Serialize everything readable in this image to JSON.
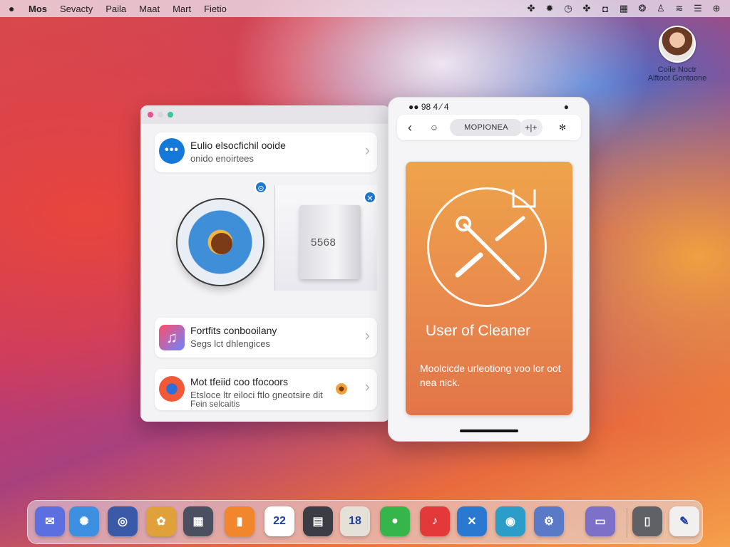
{
  "menubar": {
    "apple_icon": "apple-icon",
    "items": [
      "Mos",
      "Sevacty",
      "Paila",
      "Maat",
      "Mart",
      "Fietio"
    ],
    "status_icons": [
      "puzzle-icon",
      "gear-icon",
      "clock-icon",
      "puzzle-icon",
      "screen-icon",
      "grid-icon",
      "account-icon",
      "user-icon",
      "wifi-icon",
      "menu-icon",
      "settings-icon"
    ]
  },
  "user": {
    "name": "Coile Noctr",
    "subtitle": "Alftoot Gontoone"
  },
  "left_window": {
    "card1": {
      "title": "Eulio elsocfichil ooide",
      "subtitle": "onido enoirtees",
      "icon_glyph": "•••"
    },
    "media": {
      "label": "5568",
      "badge1": "⊙",
      "badge2": "✕"
    },
    "card2": {
      "title": "Fortfits conbooilany",
      "subtitle": "Segs lct dhlengices",
      "icon_glyph": "♫"
    },
    "card3": {
      "title": "Mot tfeiid coo tfocoors",
      "subtitle": "Etsloce ltr eiloci ftlo gneotsire dit",
      "subtitle2": "Fein selcaitis"
    }
  },
  "right_window": {
    "status_left": "●● 98 4 ⁄ 4",
    "status_right": "●",
    "nav": {
      "back": "‹",
      "face": "☺",
      "pill": "MOPIONEA",
      "plus": "+|+",
      "close": "✻"
    },
    "card": {
      "title": "User of Cleaner",
      "description": "Moolcicde urleotiong voo lor oot nea nick."
    }
  },
  "dock": {
    "apps": [
      {
        "name": "mail-icon",
        "glyph": "✉",
        "color": "#5b6fe0"
      },
      {
        "name": "safari-icon",
        "glyph": "✺",
        "color": "#3d8fe2"
      },
      {
        "name": "launchpad-icon",
        "glyph": "◎",
        "color": "#3a5aa8"
      },
      {
        "name": "photos-icon",
        "glyph": "✿",
        "color": "#e0a03a"
      },
      {
        "name": "windows-icon",
        "glyph": "▦",
        "color": "#4a5060"
      },
      {
        "name": "pages-icon",
        "glyph": "▮",
        "color": "#f2862c"
      },
      {
        "name": "calendar-icon",
        "glyph": "22",
        "color": "#ffffff"
      },
      {
        "name": "grid-app-icon",
        "glyph": "▤",
        "color": "#3c3c46"
      },
      {
        "name": "numbers-app-icon",
        "glyph": "18",
        "color": "#e6e1d8"
      },
      {
        "name": "messages-icon",
        "glyph": "●",
        "color": "#36b54a"
      },
      {
        "name": "music-icon",
        "glyph": "♪",
        "color": "#e3393a"
      },
      {
        "name": "appstore-icon",
        "glyph": "✕",
        "color": "#2a79d0"
      },
      {
        "name": "camera-icon",
        "glyph": "◉",
        "color": "#2c9cc8"
      },
      {
        "name": "settings-app-icon",
        "glyph": "⚙",
        "color": "#5a7ac8"
      },
      {
        "name": "folder-icon",
        "glyph": "▭",
        "color": "#7d70c8"
      },
      {
        "name": "trash-icon",
        "glyph": "▯",
        "color": "#5f6166"
      },
      {
        "name": "notes-icon",
        "glyph": "✎",
        "color": "#f1f0ee"
      }
    ]
  }
}
